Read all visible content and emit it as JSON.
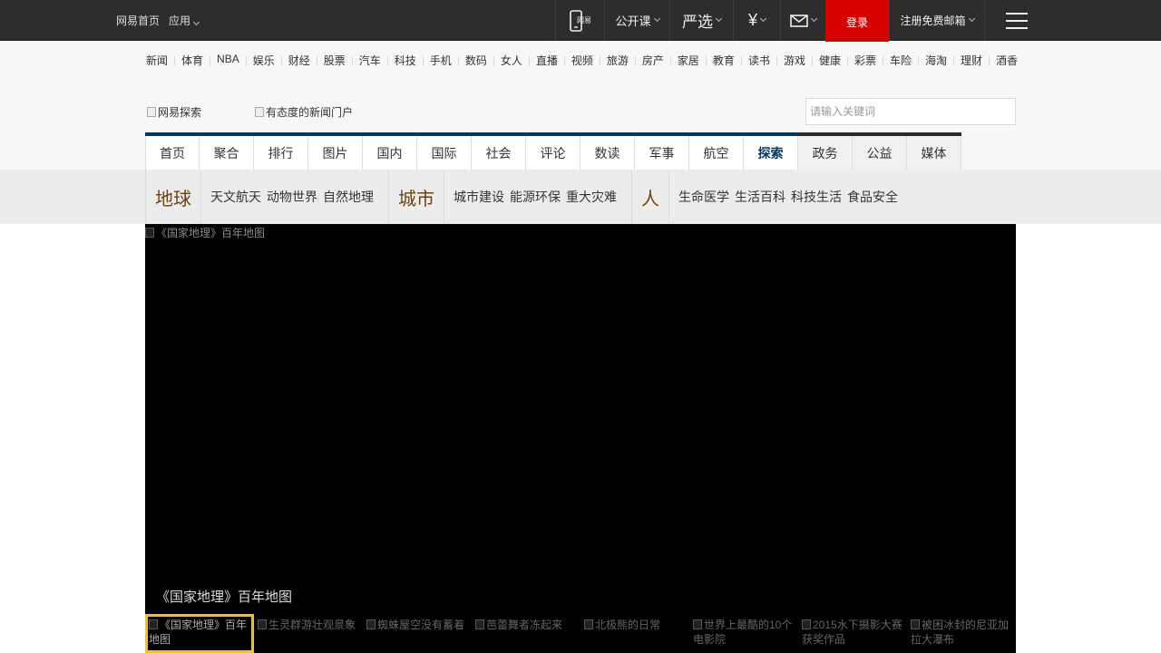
{
  "topbar": {
    "home": "网易首页",
    "apps": "应用",
    "mobile_icon": "phone-icon",
    "mobile_label": "网易",
    "open_course": "公开课",
    "yanxuan": "严选",
    "pay_icon": "yen-icon",
    "mail_icon": "mail-icon",
    "login": "登录",
    "register": "注册免费邮箱"
  },
  "channels": [
    "新闻",
    "体育",
    "NBA",
    "娱乐",
    "财经",
    "股票",
    "汽车",
    "科技",
    "手机",
    "数码",
    "女人",
    "直播",
    "视频",
    "旅游",
    "房产",
    "家居",
    "教育",
    "读书",
    "游戏",
    "健康",
    "彩票",
    "车险",
    "海淘",
    "理财",
    "酒香"
  ],
  "logo": {
    "alt": "网易探索",
    "slogan_alt": "有态度的新闻门户"
  },
  "search": {
    "placeholder": "请输入关键词"
  },
  "nav": [
    "首页",
    "聚合",
    "排行",
    "图片",
    "国内",
    "国际",
    "社会",
    "评论",
    "数读",
    "军事",
    "航空",
    "探索",
    "政务",
    "公益",
    "媒体"
  ],
  "subnav": [
    {
      "head": "地球",
      "links": [
        "天文航天",
        "动物世界",
        "自然地理"
      ]
    },
    {
      "head": "城市",
      "links": [
        "城市建设",
        "能源环保",
        "重大灾难"
      ]
    },
    {
      "head": "人",
      "links": [
        "生命医学",
        "生活百科",
        "科技生活",
        "食品安全"
      ]
    }
  ],
  "gallery": {
    "main_alt": "《国家地理》百年地图",
    "caption": "《国家地理》百年地图",
    "thumbs": [
      "《国家地理》百年地图",
      "生灵群游壮观景象",
      "蜘蛛屋空没有蓄着",
      "芭蕾舞者冻起来",
      "北极熊的日常",
      "世界上最酷的10个电影院",
      "2015水下摄影大赛获奖作品",
      "被困冰封的尼亚加拉大瀑布"
    ]
  }
}
